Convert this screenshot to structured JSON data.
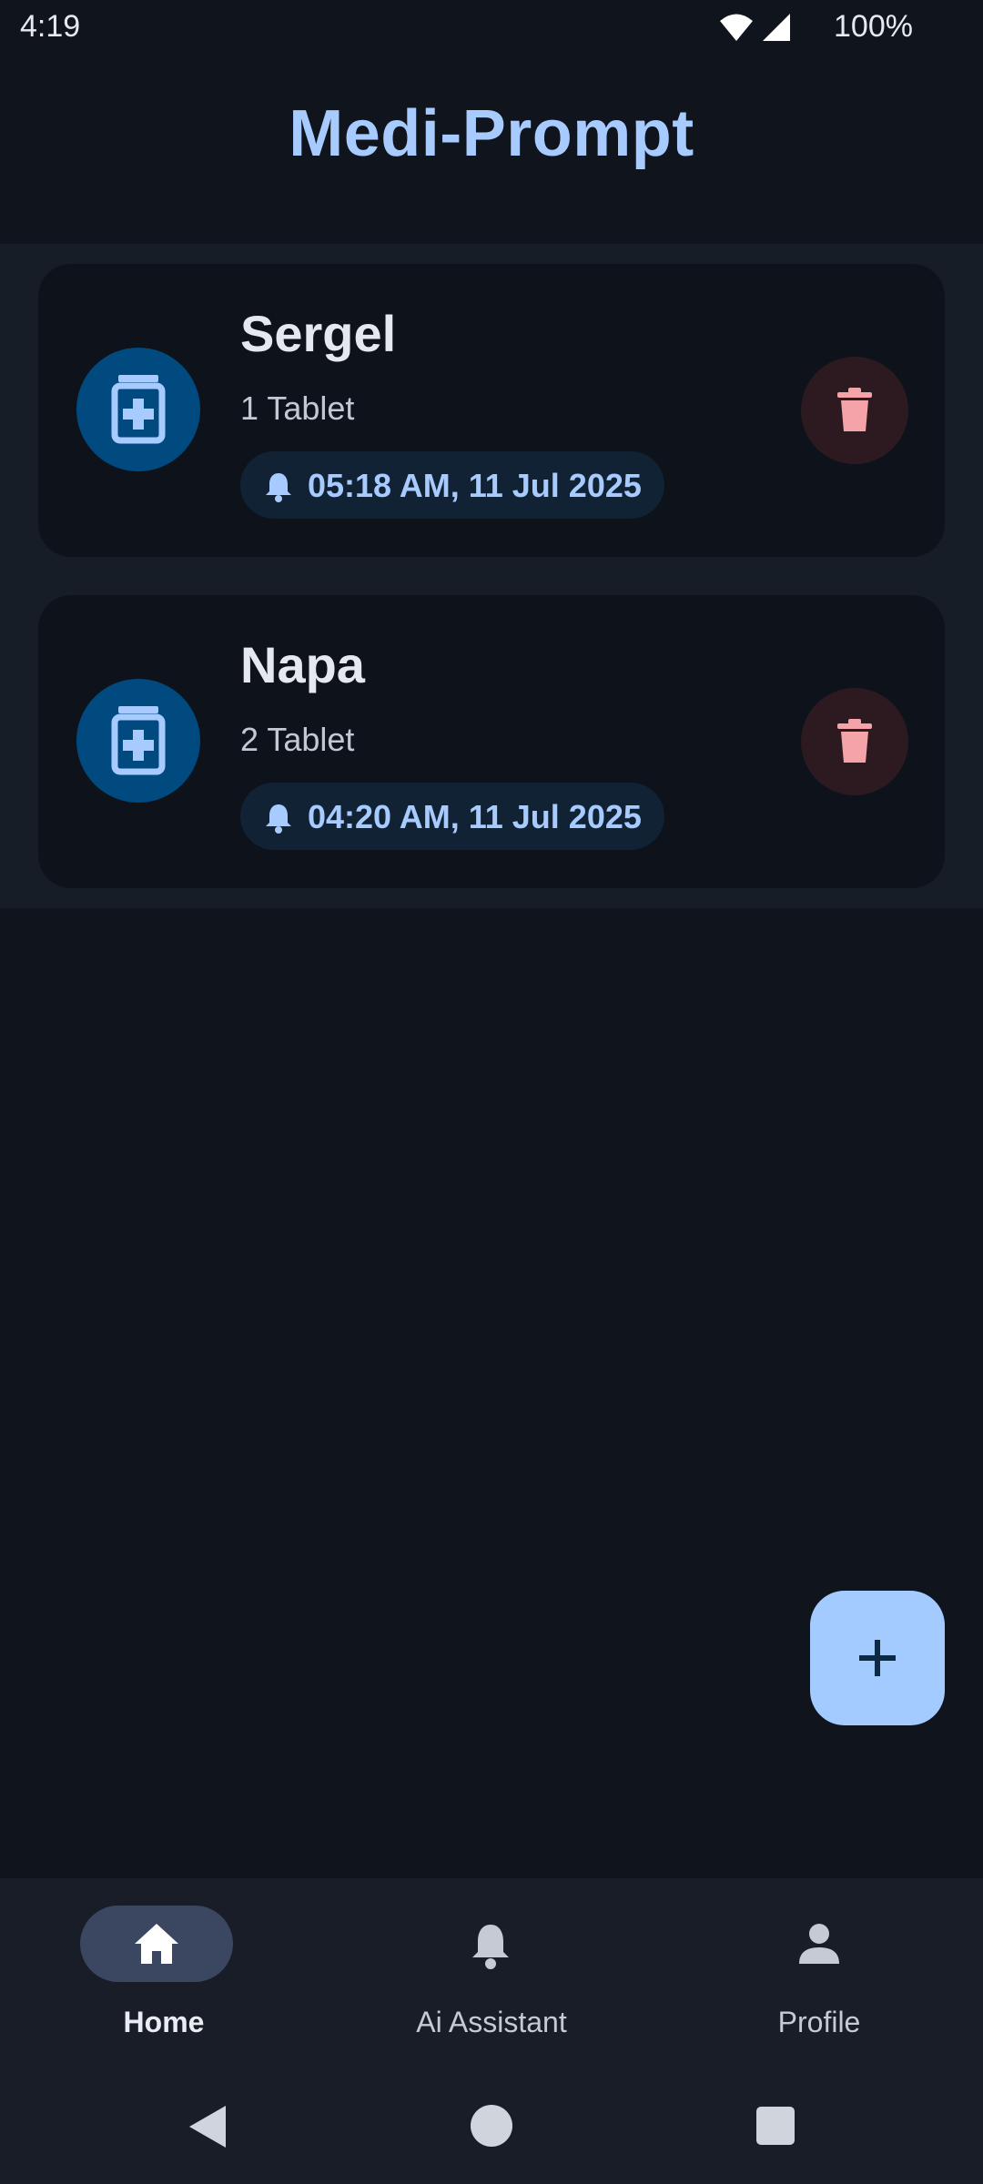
{
  "status_bar": {
    "time": "4:19",
    "battery": "100%"
  },
  "app": {
    "title": "Medi-Prompt"
  },
  "medicines": [
    {
      "name": "Sergel",
      "dose": "1 Tablet",
      "reminder": "05:18 AM, 11 Jul 2025"
    },
    {
      "name": "Napa",
      "dose": "2 Tablet",
      "reminder": "04:20 AM, 11 Jul 2025"
    }
  ],
  "fab": {
    "icon": "plus-icon"
  },
  "nav": {
    "items": [
      {
        "label": "Home",
        "icon": "home-icon",
        "active": true
      },
      {
        "label": "Ai Assistant",
        "icon": "bell-icon",
        "active": false
      },
      {
        "label": "Profile",
        "icon": "person-icon",
        "active": false
      }
    ]
  },
  "colors": {
    "background": "#0f141d",
    "accent": "#a7cbff",
    "card": "#0e131b",
    "delete": "#f4a3a8",
    "fab": "#a4cbff"
  }
}
